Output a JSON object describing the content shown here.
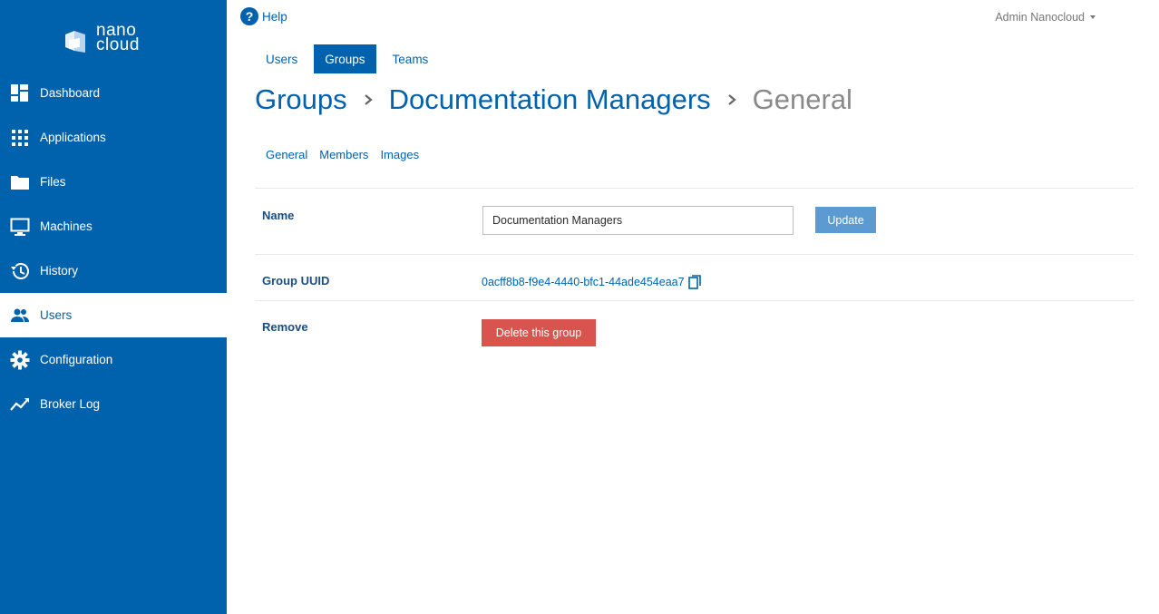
{
  "brand": {
    "line1": "nano",
    "line2": "cloud",
    "icon": "nanocloud-logo"
  },
  "sidebar": {
    "items": [
      {
        "label": "Dashboard",
        "icon": "dashboard-icon",
        "active": false
      },
      {
        "label": "Applications",
        "icon": "apps-grid-icon",
        "active": false
      },
      {
        "label": "Files",
        "icon": "folder-icon",
        "active": false
      },
      {
        "label": "Machines",
        "icon": "monitor-icon",
        "active": false
      },
      {
        "label": "History",
        "icon": "history-icon",
        "active": false
      },
      {
        "label": "Users",
        "icon": "users-icon",
        "active": true
      },
      {
        "label": "Configuration",
        "icon": "gear-icon",
        "active": false
      },
      {
        "label": "Broker Log",
        "icon": "trend-line-icon",
        "active": false
      }
    ]
  },
  "header": {
    "help_label": "Help",
    "help_glyph": "?",
    "user_label": "Admin Nanocloud"
  },
  "top_tabs": [
    {
      "label": "Users",
      "active": false
    },
    {
      "label": "Groups",
      "active": true
    },
    {
      "label": "Teams",
      "active": false
    }
  ],
  "breadcrumb": {
    "root": "Groups",
    "item": "Documentation Managers",
    "current": "General"
  },
  "sub_tabs": [
    {
      "label": "General"
    },
    {
      "label": "Members"
    },
    {
      "label": "Images"
    }
  ],
  "form": {
    "name_label": "Name",
    "name_value": "Documentation Managers",
    "update_label": "Update",
    "uuid_label": "Group UUID",
    "uuid_value": "0acff8b8-f9e4-4440-bfc1-44ade454eaa7",
    "remove_label": "Remove",
    "delete_label": "Delete this group"
  },
  "colors": {
    "primary": "#0062ad",
    "update_button": "#5b9bd1",
    "danger": "#d9534f"
  }
}
